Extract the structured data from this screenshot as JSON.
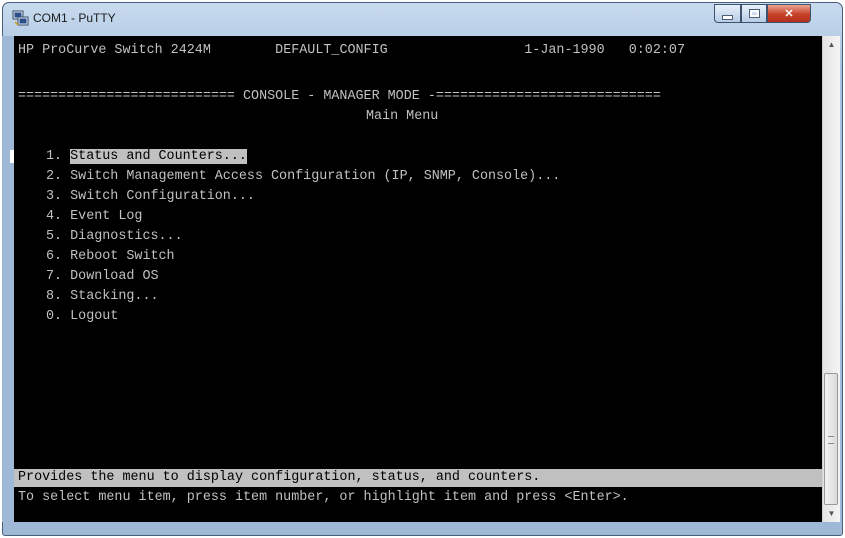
{
  "window": {
    "title": "COM1 - PuTTY",
    "icon": "putty-icon",
    "controls": {
      "minimize": "minimize-icon",
      "maximize": "maximize-icon",
      "close": "close-icon"
    }
  },
  "terminal": {
    "header": {
      "device": "HP ProCurve Switch 2424M",
      "config": "DEFAULT_CONFIG",
      "date": "1-Jan-1990",
      "time": "0:02:07"
    },
    "banner": "=========================== CONSOLE - MANAGER MODE -============================",
    "menu_title": "Main Menu",
    "menu_items": [
      {
        "number": "1.",
        "label": "Status and Counters...",
        "selected": true
      },
      {
        "number": "2.",
        "label": "Switch Management Access Configuration (IP, SNMP, Console)...",
        "selected": false
      },
      {
        "number": "3.",
        "label": "Switch Configuration...",
        "selected": false
      },
      {
        "number": "4.",
        "label": "Event Log",
        "selected": false
      },
      {
        "number": "5.",
        "label": "Diagnostics...",
        "selected": false
      },
      {
        "number": "6.",
        "label": "Reboot Switch",
        "selected": false
      },
      {
        "number": "7.",
        "label": "Download OS",
        "selected": false
      },
      {
        "number": "8.",
        "label": "Stacking...",
        "selected": false
      },
      {
        "number": "0.",
        "label": "Logout",
        "selected": false
      }
    ],
    "help_text": "Provides the menu to display configuration, status, and counters.",
    "instruction": "To select menu item, press item number, or highlight item and press <Enter>."
  },
  "scrollbar": {
    "up": "▲",
    "down": "▼"
  },
  "colors": {
    "terminal_bg": "#000000",
    "terminal_fg": "#c0c0c0",
    "highlight_bg": "#c0c0c0",
    "close_button": "#c7402a"
  }
}
